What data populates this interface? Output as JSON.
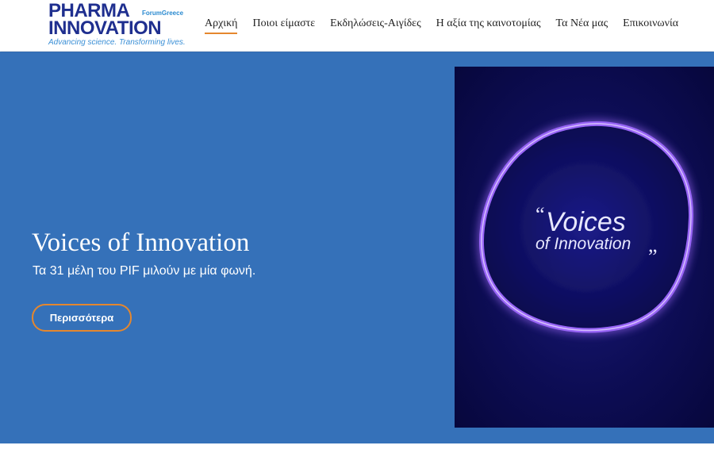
{
  "brand": {
    "logo_line1": "PHARMA",
    "logo_line2": "INNOVATION",
    "logo_forum": "ForumGreece",
    "logo_tagline": "Advancing science. Transforming lives."
  },
  "nav": {
    "items": [
      {
        "label": "Αρχική",
        "active": true
      },
      {
        "label": "Ποιοι είμαστε"
      },
      {
        "label": "Εκδηλώσεις-Αιγίδες"
      },
      {
        "label": "Η αξία της καινοτομίας"
      },
      {
        "label": "Τα Νέα μας"
      },
      {
        "label": "Επικοινωνία"
      }
    ]
  },
  "hero": {
    "title": "Voices of Innovation",
    "subtitle": "Τα 31 μέλη του PIF μιλούν με μία φωνή.",
    "button_label": "Περισσότερα"
  },
  "promo": {
    "line1": "Voices",
    "line2": "of Innovation",
    "open_quote": "“",
    "close_quote": "„"
  },
  "colors": {
    "hero_bg": "#3571b9",
    "accent_orange": "#e5872e",
    "brand_blue": "#1f2f8f",
    "promo_glow": "#9b5cff"
  }
}
